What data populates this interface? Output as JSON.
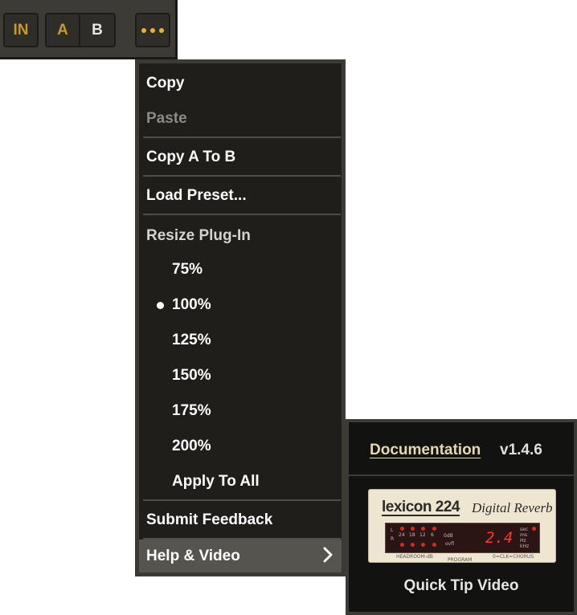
{
  "toolbar": {
    "in_label": "IN",
    "a_label": "A",
    "b_label": "B",
    "more_icon": "ellipsis-icon"
  },
  "menu": {
    "copy": "Copy",
    "paste": "Paste",
    "copy_a_to_b": "Copy A To B",
    "load_preset": "Load Preset...",
    "resize_header": "Resize Plug-In",
    "sizes": [
      "75%",
      "100%",
      "125%",
      "150%",
      "175%",
      "200%"
    ],
    "selected_size": "100%",
    "apply_to_all": "Apply To All",
    "submit_feedback": "Submit Feedback",
    "help_video": "Help & Video"
  },
  "submenu": {
    "documentation": "Documentation",
    "version": "v1.4.6",
    "thumbnail": {
      "brand": "lexicon 224",
      "tagline": "Digital Reverb",
      "display_value": "2.4",
      "meter_scale": [
        "L",
        "R",
        "24",
        "18",
        "12",
        "6",
        "0dB",
        "ovfl"
      ],
      "units": [
        "sec",
        "ms",
        "Hz",
        "kHz"
      ],
      "footer": [
        "HEADROOM-dB",
        "PROGRAM",
        "0=CLK=CHORUS"
      ]
    },
    "quick_tip": "Quick Tip Video"
  },
  "colors": {
    "accent": "#c89a2a",
    "menu_bg": "#1f1e1b",
    "highlight": "#55544f"
  }
}
